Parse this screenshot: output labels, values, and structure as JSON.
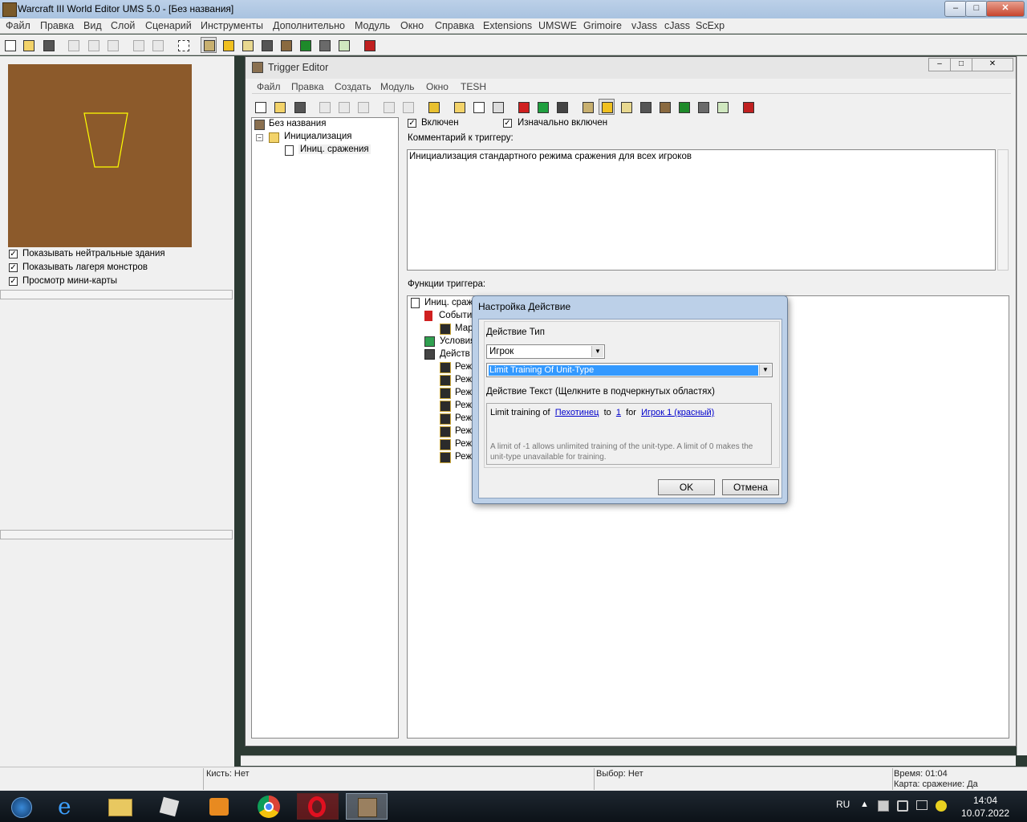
{
  "main_window": {
    "title": "Warcraft III World Editor UMS 5.0 - [Без названия]",
    "caption_buttons": {
      "minimize": "‒",
      "maximize": "□",
      "close": "✕"
    }
  },
  "menu": {
    "items": [
      "Файл",
      "Правка",
      "Вид",
      "Слой",
      "Сценарий",
      "Инструменты",
      "Дополнительно",
      "Модуль",
      "Окно",
      "Справка",
      "Extensions",
      "UMSWE",
      "Grimoire",
      "vJass",
      "cJass",
      "ScExp"
    ]
  },
  "left_panel": {
    "checkboxes": [
      {
        "label": "Показывать нейтральные здания",
        "checked": true
      },
      {
        "label": "Показывать лагеря монстров",
        "checked": true
      },
      {
        "label": "Просмотр мини-карты",
        "checked": true
      }
    ],
    "check_mark": "✓"
  },
  "trigger_editor": {
    "title": "Trigger Editor",
    "caption_buttons": {
      "minimize": "–",
      "maximize": "□",
      "close": "✕"
    },
    "menu": [
      "Файл",
      "Правка",
      "Создать",
      "Модуль",
      "Окно",
      "TESH"
    ],
    "tree": {
      "root": "Без названия",
      "category": "Инициализация",
      "trigger": "Иниц. сражения"
    },
    "enabled_label": "Включен",
    "initially_on_label": "Изначально включен",
    "comment_label": "Комментарий к триггеру:",
    "comment_text": "Инициализация стандартного режима сражения для всех игроков",
    "functions_label": "Функции триггера:",
    "functions": {
      "root": "Иниц. сраж",
      "events": "События",
      "event_item": "Мар",
      "conditions": "Условия",
      "actions": "Действ",
      "action_items": [
        "Реж",
        "Реж",
        "Реж",
        "Реж",
        "Реж",
        "Реж",
        "Реж",
        "Реж"
      ]
    }
  },
  "dialog": {
    "title": "Настройка Действие",
    "type_label": "Действие Тип",
    "category_value": "Игрок",
    "action_value": "Limit Training Of Unit-Type",
    "text_label": "Действие Текст (Щелкните в подчеркнутых областях)",
    "action_text": {
      "part1": "Limit training of",
      "link1": "Пехотинец",
      "part2": "to",
      "link2": "1",
      "part3": "for",
      "link3": "Игрок 1 (красный)"
    },
    "hint": "A limit of -1 allows unlimited training of the unit-type.  A limit of 0 makes the unit-type unavailable for training.",
    "ok_label": "OK",
    "cancel_label": "Отмена"
  },
  "status_bar": {
    "brush": "Кисть: Нет",
    "selection": "Выбор: Нет",
    "time": "Время: 01:04",
    "map": "Карта: сражение: Да"
  },
  "taskbar": {
    "language": "RU",
    "clock_time": "14:04",
    "clock_date": "10.07.2022",
    "apps": [
      "windows-start",
      "internet-explorer",
      "file-explorer",
      "roblox",
      "media-player",
      "chrome",
      "opera",
      "world-editor"
    ]
  },
  "colors": {
    "minimap_ground": "#8c5a2b",
    "selection_blue": "#3399ff",
    "link_blue": "#0000cc",
    "camera_outline": "#ffff00"
  }
}
